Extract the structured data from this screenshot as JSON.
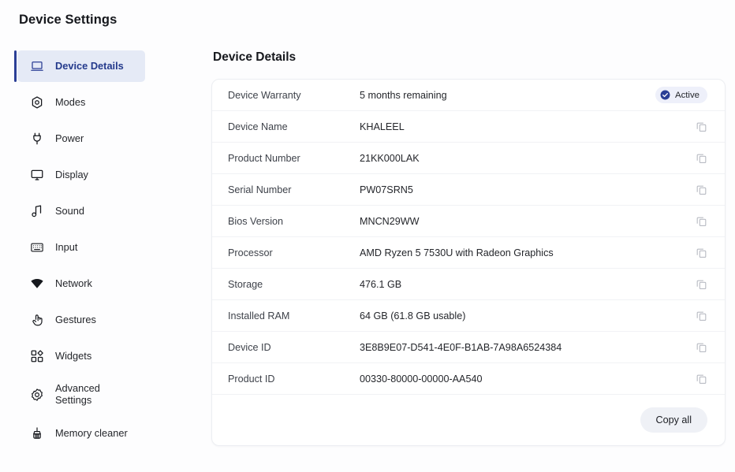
{
  "app": {
    "title": "Device Settings",
    "accent_color": "#2b3f96",
    "active_nav_bg": "#e5eaf6",
    "card_bg": "#ffffff",
    "page_bg": "#fdfdfe"
  },
  "sidebar": {
    "items": [
      {
        "label": "Device Details",
        "icon": "laptop-icon",
        "active": true
      },
      {
        "label": "Modes",
        "icon": "hexagon-icon",
        "active": false
      },
      {
        "label": "Power",
        "icon": "power-plug-icon",
        "active": false
      },
      {
        "label": "Display",
        "icon": "monitor-icon",
        "active": false
      },
      {
        "label": "Sound",
        "icon": "music-note-icon",
        "active": false
      },
      {
        "label": "Input",
        "icon": "keyboard-icon",
        "active": false
      },
      {
        "label": "Network",
        "icon": "wifi-icon",
        "active": false
      },
      {
        "label": "Gestures",
        "icon": "hand-tap-icon",
        "active": false
      },
      {
        "label": "Widgets",
        "icon": "widgets-grid-icon",
        "active": false
      },
      {
        "label": "Advanced\nSettings",
        "icon": "gear-icon",
        "active": false
      },
      {
        "label": "Memory cleaner",
        "icon": "broom-icon",
        "active": false
      }
    ]
  },
  "main": {
    "section_title": "Device Details",
    "rows": [
      {
        "label": "Device Warranty",
        "value": "5 months remaining",
        "action": "badge",
        "badge_label": "Active"
      },
      {
        "label": "Device Name",
        "value": "KHALEEL",
        "action": "copy"
      },
      {
        "label": "Product Number",
        "value": "21KK000LAK",
        "action": "copy"
      },
      {
        "label": "Serial Number",
        "value": "PW07SRN5",
        "action": "copy"
      },
      {
        "label": "Bios Version",
        "value": "MNCN29WW",
        "action": "copy"
      },
      {
        "label": "Processor",
        "value": "AMD Ryzen 5 7530U with Radeon Graphics",
        "action": "copy"
      },
      {
        "label": "Storage",
        "value": "476.1 GB",
        "action": "copy"
      },
      {
        "label": "Installed RAM",
        "value": "64 GB (61.8 GB usable)",
        "action": "copy"
      },
      {
        "label": "Device ID",
        "value": "3E8B9E07-D541-4E0F-B1AB-7A98A6524384",
        "action": "copy"
      },
      {
        "label": "Product ID",
        "value": "00330-80000-00000-AA540",
        "action": "copy"
      }
    ],
    "copy_all_label": "Copy all"
  }
}
